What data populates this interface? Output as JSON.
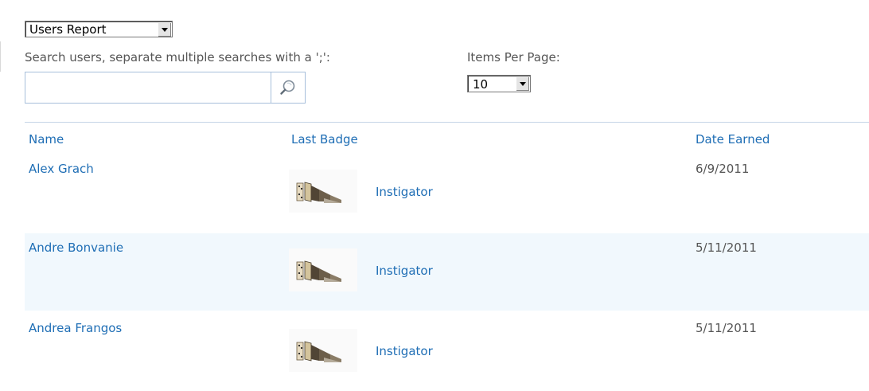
{
  "report_select": {
    "value": "Users Report"
  },
  "search": {
    "label": "Search users, separate multiple searches with a ';':",
    "value": "",
    "placeholder": "",
    "button_icon": "magnifier-icon"
  },
  "items_per_page": {
    "label": "Items Per Page:",
    "value": "10"
  },
  "table": {
    "columns": [
      "Name",
      "Last Badge",
      "Date Earned"
    ],
    "rows": [
      {
        "name": "Alex Grach",
        "badge": "Instigator",
        "badge_icon": "domino-badge-icon",
        "date": "6/9/2011"
      },
      {
        "name": "Andre Bonvanie",
        "badge": "Instigator",
        "badge_icon": "domino-badge-icon",
        "date": "5/11/2011"
      },
      {
        "name": "Andrea Frangos",
        "badge": "Instigator",
        "badge_icon": "domino-badge-icon",
        "date": "5/11/2011"
      }
    ]
  },
  "colors": {
    "link": "#1f6eb5",
    "alt_row": "#f1f8fd",
    "rule": "#c6d5e7"
  }
}
